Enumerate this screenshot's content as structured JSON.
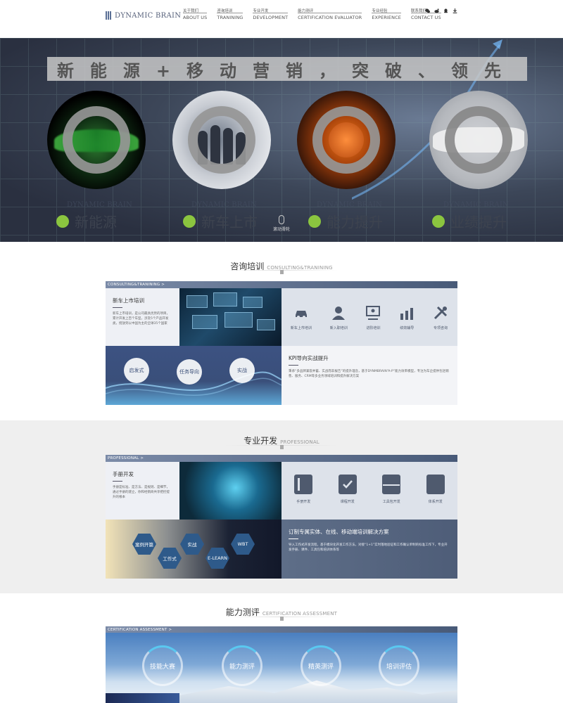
{
  "header": {
    "logo_text": "DYNAMIC BRAIN",
    "nav": [
      {
        "cn": "关于我们",
        "en": "ABOUT US"
      },
      {
        "cn": "咨询培训",
        "en": "TRANINING"
      },
      {
        "cn": "专业开发",
        "en": "DEVELOPMENT"
      },
      {
        "cn": "能力测评",
        "en": "CERTIFICATION EVALUATOR"
      },
      {
        "cn": "专业经验",
        "en": "EXPERIENCE"
      },
      {
        "cn": "联系我们",
        "en": "CONTACT US"
      }
    ],
    "icons": [
      "wechat-icon",
      "weibo-icon",
      "qq-icon",
      "download-icon"
    ]
  },
  "banner": {
    "slogan": "新能源+移动营销，突破、领先",
    "items": [
      {
        "label": "新能源",
        "ghost": "DYNAMIC BRAIN"
      },
      {
        "label": "新车上市",
        "ghost": "DYNAMIC BRAIN"
      },
      {
        "label": "能力提升",
        "ghost": "DYNAMIC BRAIN"
      },
      {
        "label": "业绩提升",
        "ghost": "DYNAMIC BRAIN"
      }
    ],
    "scroll_hint": "滚动滑轮"
  },
  "consulting": {
    "title_cn": "咨询培训",
    "title_en": "CONSULTING&TRANINING",
    "bar": "CONSULTING&TRANINING >",
    "card_title": "新车上市培训",
    "card_text": "新车上市培训，是公司最具优势的项目，累计开发上百个车型，涉及5个产品开发类，授放到以中国为主的全球35个国家",
    "icons": [
      "新车上市培训",
      "新入职培训",
      "进阶培训",
      "绩效辅导",
      "专项咨询"
    ],
    "bubbles": [
      "启发式",
      "任务导向",
      "实战"
    ],
    "kpi_title": "KPI导向实战提升",
    "kpi_text": "秉承“多品牌兼容并蓄、实战而非报告”的提升理念，基于DYNMBRAIN“A-P”能力效率模型，专注为车企提供包括销售、服务、CRM等多业务领域培训和提升解决方案"
  },
  "professional": {
    "title_cn": "专业开发",
    "title_en": "PROFESSIONAL",
    "bar": "PROFESSIONAL >",
    "card_title": "手册开发",
    "card_text": "手册是标准、是方法、是规则、是细节，通过手册的建立，你和经销商共享把控提升的根本",
    "icons": [
      "手册开发",
      "课程开发",
      "工具包开发",
      "体系开发"
    ],
    "hexes": [
      "案例开篇",
      "工作式",
      "实战",
      "E-LEARN",
      "WBT"
    ],
    "right_title": "订制专属实体、在线、移动端培训解决方案",
    "right_text": "导入工作式开发流程，基于模块化开发工作方法，对接“1+1”实时落地验证和工作确认单制的标准工作下，专业开发手册、课件、工具包和培训体系等"
  },
  "certification": {
    "title_cn": "能力测评",
    "title_en": "CERTIFICATION ASSESSMENT",
    "bar": "CERTIFICATION ASSESSMENT >",
    "rings": [
      "技能大赛",
      "能力测评",
      "精英测评",
      "培训评估"
    ]
  },
  "colors": {
    "accent": "#8bc53f",
    "panel": "#5e6e88",
    "icon": "#4f5a6e"
  }
}
